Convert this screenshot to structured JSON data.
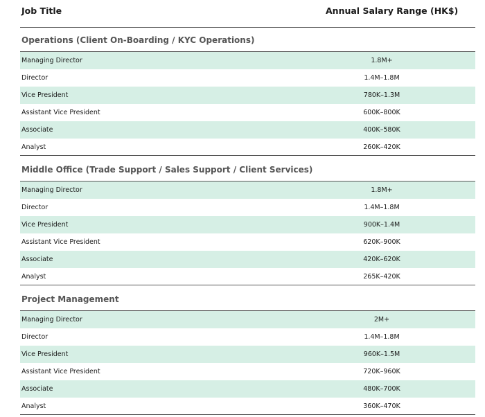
{
  "header": {
    "job_title": "Job Title",
    "salary_range": "Annual Salary Range (HK$)"
  },
  "sections": [
    {
      "title": "Operations (Client On-Boarding / KYC Operations)",
      "rows": [
        {
          "title": "Managing Director",
          "range": "1.8M+"
        },
        {
          "title": "Director",
          "range": "1.4M–1.8M"
        },
        {
          "title": "Vice President",
          "range": "780K–1.3M"
        },
        {
          "title": "Assistant Vice President",
          "range": "600K–800K"
        },
        {
          "title": "Associate",
          "range": "400K–580K"
        },
        {
          "title": "Analyst",
          "range": "260K–420K"
        }
      ]
    },
    {
      "title": "Middle Office (Trade Support / Sales Support / Client Services)",
      "rows": [
        {
          "title": "Managing Director",
          "range": "1.8M+"
        },
        {
          "title": "Director",
          "range": "1.4M–1.8M"
        },
        {
          "title": "Vice President",
          "range": "900K–1.4M"
        },
        {
          "title": "Assistant Vice President",
          "range": "620K–900K"
        },
        {
          "title": "Associate",
          "range": "420K–620K"
        },
        {
          "title": "Analyst",
          "range": "265K–420K"
        }
      ]
    },
    {
      "title": "Project Management",
      "rows": [
        {
          "title": "Managing Director",
          "range": "2M+"
        },
        {
          "title": "Director",
          "range": "1.4M–1.8M"
        },
        {
          "title": "Vice President",
          "range": "960K–1.5M"
        },
        {
          "title": "Assistant Vice President",
          "range": "720K–960K"
        },
        {
          "title": "Associate",
          "range": "480K–700K"
        },
        {
          "title": "Analyst",
          "range": "360K–470K"
        }
      ]
    }
  ],
  "colors": {
    "row_shade": "#d6efe5",
    "section_title": "#555555",
    "rule": "#555555"
  }
}
